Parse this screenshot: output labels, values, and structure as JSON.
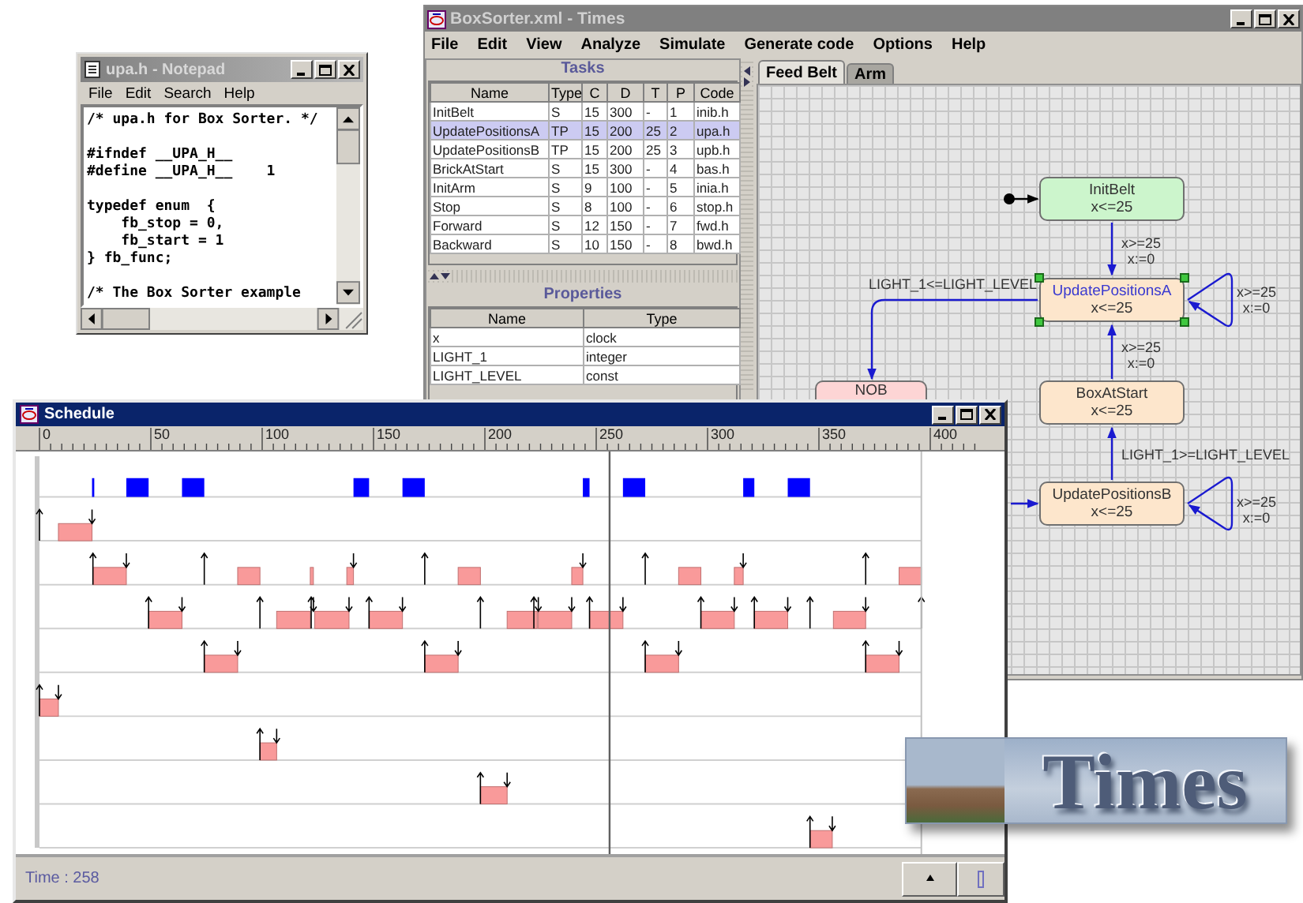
{
  "notepad": {
    "title": "upa.h - Notepad",
    "menu": [
      "File",
      "Edit",
      "Search",
      "Help"
    ],
    "code_blocks": [
      [
        "/* upa.h for Box Sorter. */"
      ],
      [
        "#ifndef __UPA_H__",
        "#define __UPA_H__    1"
      ],
      [
        "typedef enum  {",
        "    fb_stop = 0,",
        "    fb_start = 1",
        "} fb_func;"
      ],
      [
        "/* The Box Sorter example"
      ]
    ]
  },
  "times_window": {
    "title": "BoxSorter.xml - Times",
    "menu": [
      "File",
      "Edit",
      "View",
      "Analyze",
      "Simulate",
      "Generate code",
      "Options",
      "Help"
    ],
    "tasks": {
      "title": "Tasks",
      "columns": [
        "Name",
        "Type",
        "C",
        "D",
        "T",
        "P",
        "Code"
      ],
      "rows": [
        {
          "cells": [
            "InitBelt",
            "S",
            "15",
            "300",
            "-",
            "1",
            "inib.h"
          ],
          "selected": false
        },
        {
          "cells": [
            "UpdatePositionsA",
            "TP",
            "15",
            "200",
            "25",
            "2",
            "upa.h"
          ],
          "selected": true
        },
        {
          "cells": [
            "UpdatePositionsB",
            "TP",
            "15",
            "200",
            "25",
            "3",
            "upb.h"
          ],
          "selected": false
        },
        {
          "cells": [
            "BrickAtStart",
            "S",
            "15",
            "300",
            "-",
            "4",
            "bas.h"
          ],
          "selected": false
        },
        {
          "cells": [
            "InitArm",
            "S",
            "9",
            "100",
            "-",
            "5",
            "inia.h"
          ],
          "selected": false
        },
        {
          "cells": [
            "Stop",
            "S",
            "8",
            "100",
            "-",
            "6",
            "stop.h"
          ],
          "selected": false
        },
        {
          "cells": [
            "Forward",
            "S",
            "12",
            "150",
            "-",
            "7",
            "fwd.h"
          ],
          "selected": false
        },
        {
          "cells": [
            "Backward",
            "S",
            "10",
            "150",
            "-",
            "8",
            "bwd.h"
          ],
          "selected": false
        }
      ]
    },
    "properties": {
      "title": "Properties",
      "columns": [
        "Name",
        "Type"
      ],
      "rows": [
        {
          "cells": [
            "x",
            "clock"
          ]
        },
        {
          "cells": [
            "LIGHT_1",
            "integer"
          ]
        },
        {
          "cells": [
            "LIGHT_LEVEL",
            "const"
          ]
        }
      ]
    },
    "tabs": [
      {
        "label": "Feed Belt",
        "selected": true
      },
      {
        "label": "Arm",
        "selected": false
      }
    ],
    "diagram": {
      "locations": [
        {
          "name": "InitBelt",
          "invariant": "x<=25",
          "color": "#ccf5cc",
          "selected": false
        },
        {
          "name": "UpdatePositionsA",
          "invariant": "x<=25",
          "color": "#fde6cc",
          "selected": true
        },
        {
          "name": "NOB",
          "color": "#fdd5d5",
          "selected": false
        },
        {
          "name": "BoxAtStart",
          "invariant": "x<=25",
          "color": "#fde6cc",
          "selected": false
        },
        {
          "name": "UpdatePositionsB",
          "invariant": "x<=25",
          "color": "#fde6cc",
          "selected": false
        }
      ],
      "transitions": [
        {
          "guard": "x>=25",
          "assignment": "x:=0"
        },
        {
          "guard": "LIGHT_1<=LIGHT_LEVEL"
        },
        {
          "guard": "x>=25",
          "assignment": "x:=0"
        },
        {
          "guard": "x>=25",
          "assignment": "x:=0"
        },
        {
          "guard": "LIGHT_1>=LIGHT_LEVEL"
        },
        {
          "guard": "x>=25",
          "assignment": "x:=0"
        }
      ]
    }
  },
  "schedule_window": {
    "title": "Schedule",
    "ruler_labels": [
      "0",
      "50",
      "100",
      "150",
      "200",
      "250",
      "300",
      "350",
      "400"
    ],
    "status": "Time : 258"
  },
  "logo": {
    "text": "Times"
  }
}
